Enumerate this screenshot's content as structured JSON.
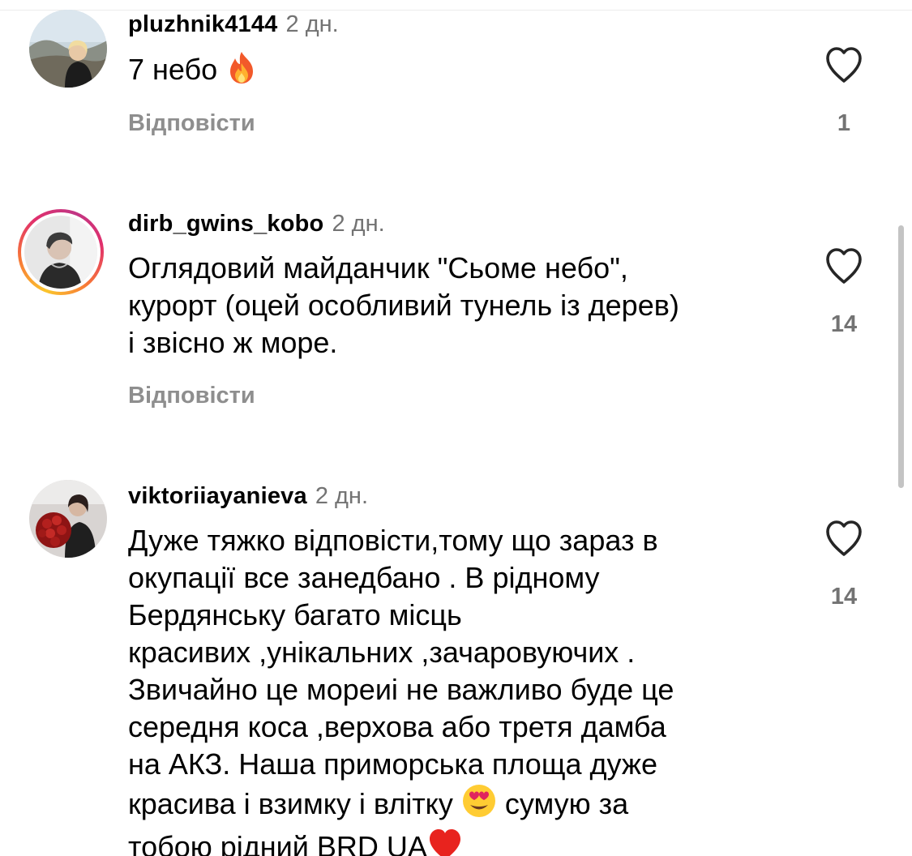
{
  "comments": [
    {
      "username": "pluzhnik4144",
      "time": "2 дн.",
      "text_lines": [
        "7 небо"
      ],
      "emoji": "fire-emoji",
      "reply_label": "Відповісти",
      "likes": "1",
      "avatar_story_ring": false
    },
    {
      "username": "dirb_gwins_kobo",
      "time": "2 дн.",
      "text_lines": [
        "Оглядовий майданчик \"Сьоме небо\",",
        "курорт (оцей особливий тунель із дерев)",
        "і звісно ж море."
      ],
      "reply_label": "Відповісти",
      "likes": "14",
      "avatar_story_ring": true
    },
    {
      "username": "viktoriiayanieva",
      "time": "2 дн.",
      "text_lines": [
        "Дуже тяжко відповісти,тому що зараз в",
        "окупації все занедбано . В рідному",
        "Бердянську багато місць",
        "красивих ,унікальних ,зачаровуючих .",
        "Звичайно це мореиі не важливо буде це",
        "середня коса ,верхова або третя дамба",
        "на АКЗ. Наша приморська площа дуже",
        "красива і взимку і влітку",
        "сумую за",
        "тобою рідний BRD UA"
      ],
      "emojis": [
        "heart-eyes-emoji",
        "red-heart-emoji"
      ],
      "likes": "14",
      "avatar_story_ring": false
    }
  ],
  "icons": {
    "like": "heart-outline-icon"
  },
  "colors": {
    "text": "#000000",
    "secondary_text": "#737373",
    "reply_text": "#8e8e8e",
    "divider": "#ececec",
    "scrollbar": "#c4c4c4"
  }
}
